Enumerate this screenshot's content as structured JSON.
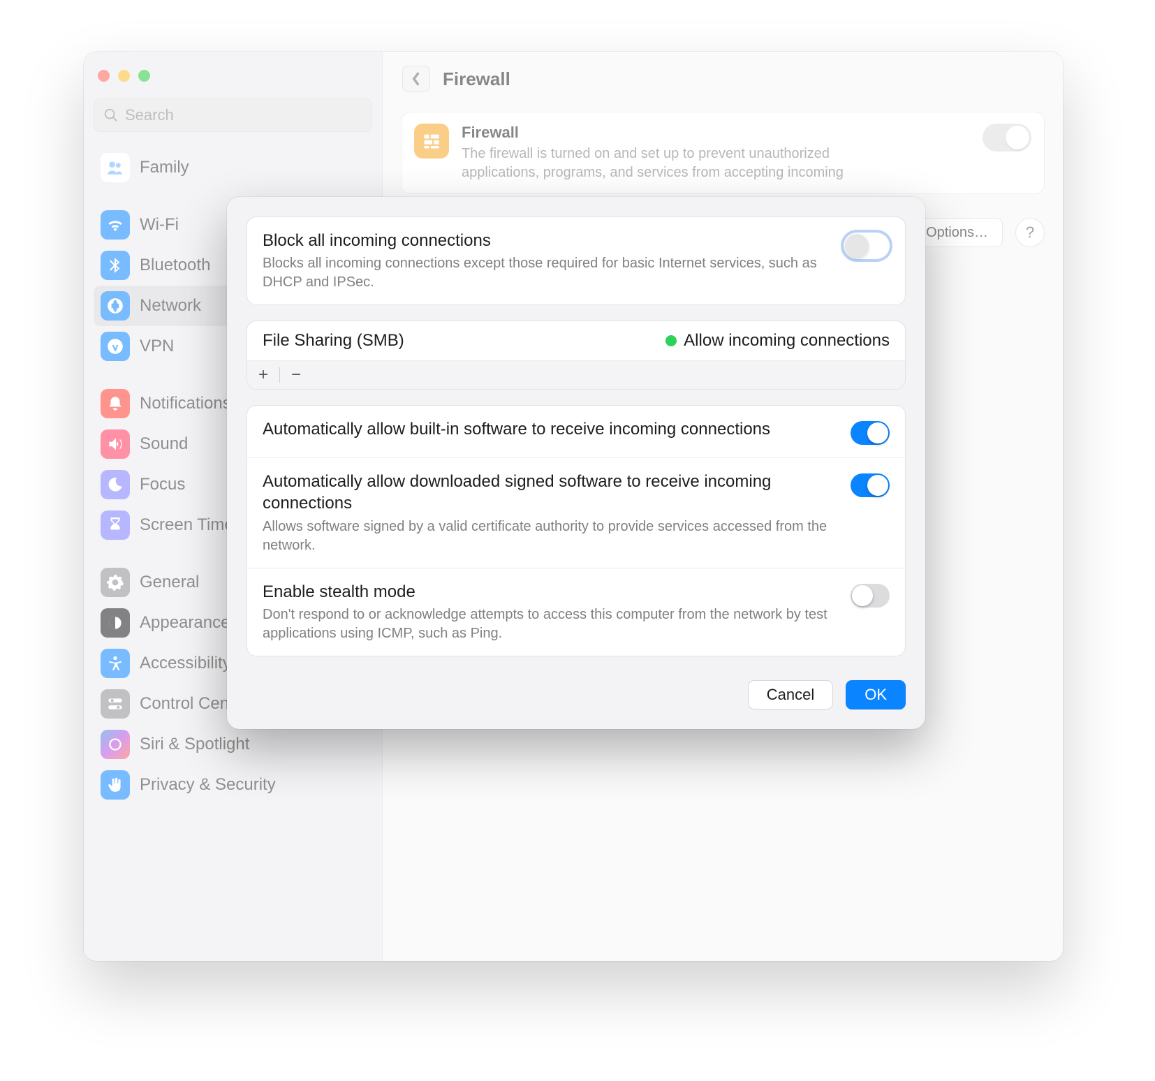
{
  "window": {
    "page_title": "Firewall",
    "search_placeholder": "Search"
  },
  "sidebar": {
    "items": [
      {
        "id": "family",
        "label": "Family",
        "bg": "#ffffff"
      },
      {
        "id": "wifi",
        "label": "Wi-Fi",
        "bg": "#0a84ff"
      },
      {
        "id": "bluetooth",
        "label": "Bluetooth",
        "bg": "#0a84ff"
      },
      {
        "id": "network",
        "label": "Network",
        "bg": "#0a84ff"
      },
      {
        "id": "vpn",
        "label": "VPN",
        "bg": "#0a84ff"
      },
      {
        "id": "notifications",
        "label": "Notifications",
        "bg": "#ff3b30"
      },
      {
        "id": "sound",
        "label": "Sound",
        "bg": "#ff3b6b"
      },
      {
        "id": "focus",
        "label": "Focus",
        "bg": "#7d7dff"
      },
      {
        "id": "screentime",
        "label": "Screen Time",
        "bg": "#7d7dff"
      },
      {
        "id": "general",
        "label": "General",
        "bg": "#9e9ea2"
      },
      {
        "id": "appearance",
        "label": "Appearance",
        "bg": "#1d1d1f"
      },
      {
        "id": "accessibility",
        "label": "Accessibility",
        "bg": "#0a84ff"
      },
      {
        "id": "controlcenter",
        "label": "Control Center",
        "bg": "#9e9ea2"
      },
      {
        "id": "sirispotlight",
        "label": "Siri & Spotlight",
        "bg": "linear-gradient(135deg,#3a8be0,#b84ee0,#ff5f57)"
      },
      {
        "id": "privacy",
        "label": "Privacy & Security",
        "bg": "#0a84ff"
      }
    ]
  },
  "firewall_card": {
    "title": "Firewall",
    "desc": "The firewall is turned on and set up to prevent unauthorized applications, programs, and services from accepting incoming",
    "options_label": "Options…",
    "help_label": "?"
  },
  "dialog": {
    "block_all": {
      "title": "Block all incoming connections",
      "desc": "Blocks all incoming connections except those required for basic Internet services, such as DHCP and IPSec.",
      "state": "off-highlight"
    },
    "list": {
      "item_name": "File Sharing (SMB)",
      "status_label": "Allow incoming connections",
      "add_label": "+",
      "remove_label": "−"
    },
    "auto_builtin": {
      "title": "Automatically allow built-in software to receive incoming connections",
      "state": "on"
    },
    "auto_signed": {
      "title": "Automatically allow downloaded signed software to receive incoming connections",
      "desc": "Allows software signed by a valid certificate authority to provide services accessed from the network.",
      "state": "on"
    },
    "stealth": {
      "title": "Enable stealth mode",
      "desc": "Don't respond to or acknowledge attempts to access this computer from the network by test applications using ICMP, such as Ping.",
      "state": "off"
    },
    "cancel_label": "Cancel",
    "ok_label": "OK"
  }
}
